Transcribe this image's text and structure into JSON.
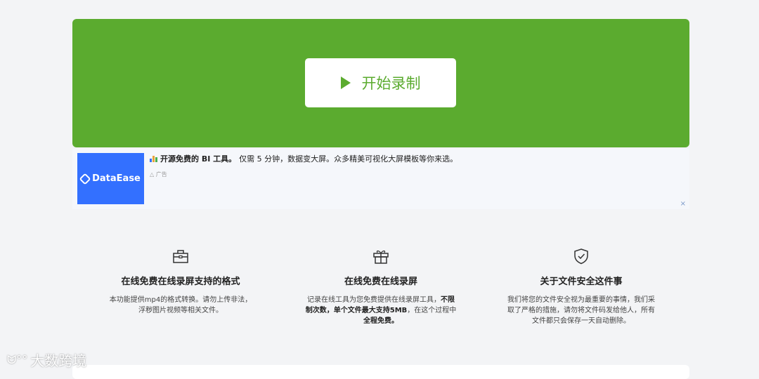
{
  "hero": {
    "start_label": "开始录制"
  },
  "ad": {
    "logo_text": "DataEase",
    "headline_bold": "开源免费的 BI 工具。",
    "headline_rest": "仅需 5 分钟，数据变大屏。众多精美可视化大屏模板等你来选。",
    "tag": "广告",
    "close": "×"
  },
  "features": [
    {
      "icon": "toolbox-icon",
      "title": "在线免费在线录屏支持的格式",
      "desc": "本功能提供mp4的格式转换。请勿上传非法，浮秽图片视频等相关文件。"
    },
    {
      "icon": "gift-icon",
      "title": "在线免费在线录屏",
      "desc_parts": [
        "记录在线工具为您免费提供在线录屏工具，",
        "不限制次数，单个文件最大支持5MB",
        "，在这个过程中",
        "全程免费。"
      ]
    },
    {
      "icon": "shield-check-icon",
      "title": "关于文件安全这件事",
      "desc": "我们将您的文件安全视为最重要的事情，我们采取了严格的措施，请勿将文件码发给他人，所有文件都只会保存一天自动删除。"
    }
  ],
  "watermark": "大数跨境",
  "colors": {
    "hero_green": "#5bab2f",
    "ad_blue": "#3370ff",
    "page_bg": "#f3f4f6"
  }
}
